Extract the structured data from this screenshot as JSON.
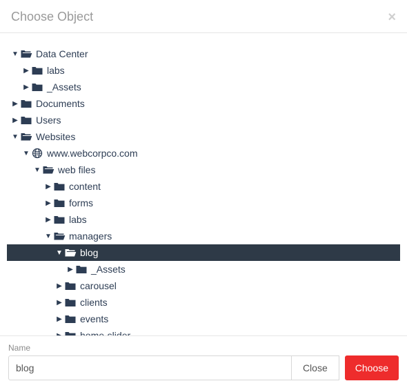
{
  "header": {
    "title": "Choose Object"
  },
  "footer": {
    "name_label": "Name",
    "name_value": "blog",
    "close_label": "Close",
    "choose_label": "Choose"
  },
  "tree": [
    {
      "id": "data_center",
      "label": "Data Center",
      "indent": 0,
      "expanded": true,
      "selected": false,
      "icon": "folder-open",
      "children": [
        {
          "id": "labs1",
          "label": "labs",
          "indent": 1,
          "expanded": false,
          "selected": false,
          "icon": "folder"
        },
        {
          "id": "assets1",
          "label": "_Assets",
          "indent": 1,
          "expanded": false,
          "selected": false,
          "icon": "folder"
        }
      ]
    },
    {
      "id": "documents",
      "label": "Documents",
      "indent": 0,
      "expanded": false,
      "selected": false,
      "icon": "folder"
    },
    {
      "id": "users",
      "label": "Users",
      "indent": 0,
      "expanded": false,
      "selected": false,
      "icon": "folder"
    },
    {
      "id": "websites",
      "label": "Websites",
      "indent": 0,
      "expanded": true,
      "selected": false,
      "icon": "folder-open",
      "children": [
        {
          "id": "site1",
          "label": "www.webcorpco.com",
          "indent": 1,
          "expanded": true,
          "selected": false,
          "icon": "globe",
          "children": [
            {
              "id": "webfiles",
              "label": "web files",
              "indent": 2,
              "expanded": true,
              "selected": false,
              "icon": "folder-open",
              "children": [
                {
                  "id": "content",
                  "label": "content",
                  "indent": 3,
                  "expanded": false,
                  "selected": false,
                  "icon": "folder"
                },
                {
                  "id": "forms",
                  "label": "forms",
                  "indent": 3,
                  "expanded": false,
                  "selected": false,
                  "icon": "folder"
                },
                {
                  "id": "labs2",
                  "label": "labs",
                  "indent": 3,
                  "expanded": false,
                  "selected": false,
                  "icon": "folder"
                },
                {
                  "id": "managers",
                  "label": "managers",
                  "indent": 3,
                  "expanded": true,
                  "selected": false,
                  "icon": "folder-open",
                  "children": [
                    {
                      "id": "blog",
                      "label": "blog",
                      "indent": 4,
                      "expanded": true,
                      "selected": true,
                      "icon": "folder-open",
                      "children": [
                        {
                          "id": "assets2",
                          "label": "_Assets",
                          "indent": 5,
                          "expanded": false,
                          "selected": false,
                          "icon": "folder"
                        }
                      ]
                    },
                    {
                      "id": "carousel",
                      "label": "carousel",
                      "indent": 4,
                      "expanded": false,
                      "selected": false,
                      "icon": "folder"
                    },
                    {
                      "id": "clients",
                      "label": "clients",
                      "indent": 4,
                      "expanded": false,
                      "selected": false,
                      "icon": "folder"
                    },
                    {
                      "id": "events",
                      "label": "events",
                      "indent": 4,
                      "expanded": false,
                      "selected": false,
                      "icon": "folder"
                    },
                    {
                      "id": "homeslider",
                      "label": "home-slider",
                      "indent": 4,
                      "expanded": false,
                      "selected": false,
                      "icon": "folder"
                    }
                  ]
                }
              ]
            }
          ]
        }
      ]
    }
  ]
}
